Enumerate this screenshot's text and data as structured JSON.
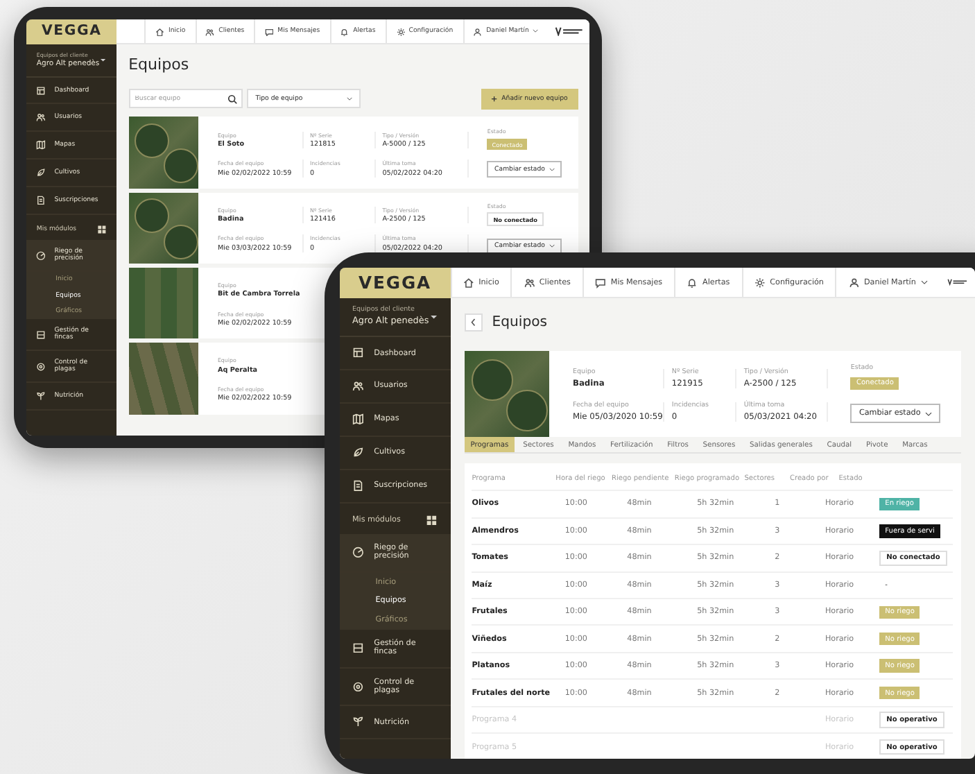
{
  "devices": [
    {
      "kind": "list",
      "header": {
        "nav": [
          {
            "label": "Inicio"
          },
          {
            "label": "Clientes"
          },
          {
            "label": "Mis Mensajes"
          },
          {
            "label": "Alertas"
          },
          {
            "label": "Configuración"
          }
        ],
        "user": "Daniel Martín"
      },
      "sidebar": {
        "logo": "VEGGA",
        "client_label": "Equipos del cliente",
        "client": "Agro Alt penedès",
        "items": [
          {
            "label": "Dashboard"
          },
          {
            "label": "Usuarios"
          },
          {
            "label": "Mapas"
          },
          {
            "label": "Cultivos"
          },
          {
            "label": "Suscripciones"
          }
        ],
        "section": "Mis módulos",
        "modules": [
          {
            "label": "Riego de precisión",
            "expanded": true,
            "children": [
              {
                "label": "Inicio",
                "selected": false
              },
              {
                "label": "Equipos",
                "selected": true
              },
              {
                "label": "Gráficos",
                "selected": false
              }
            ]
          },
          {
            "label": "Gestión de fincas",
            "expanded": false
          },
          {
            "label": "Control de plagas",
            "expanded": false
          },
          {
            "label": "Nutrición",
            "expanded": false
          }
        ]
      },
      "page": {
        "title": "Equipos",
        "search_placeholder": "Buscar equipo",
        "filter": "Tipo de equipo",
        "add_button": "Añadir nuevo equipo",
        "cards": [
          {
            "fields": [
              {
                "label": "Equipo",
                "value": "El Soto"
              },
              {
                "label": "Nº Serie",
                "value": "121815"
              },
              {
                "label": "Tipo / Versión",
                "value": "A-5000 / 125"
              },
              {
                "label": "Fecha del equipo",
                "value": "Mie 02/02/2022 10:59"
              },
              {
                "label": "Incidencias",
                "value": "0"
              },
              {
                "label": "Última toma",
                "value": "05/02/2022 04:20"
              }
            ],
            "state_label": "Estado",
            "state": {
              "label": "Conectado",
              "kind": "connected"
            },
            "button": "Cambiar estado"
          },
          {
            "fields": [
              {
                "label": "Equipo",
                "value": "Badina"
              },
              {
                "label": "Nº Serie",
                "value": "121416"
              },
              {
                "label": "Tipo / Versión",
                "value": "A-2500 / 125"
              },
              {
                "label": "Fecha del equipo",
                "value": "Mie 03/03/2022 10:59"
              },
              {
                "label": "Incidencias",
                "value": "0"
              },
              {
                "label": "Última toma",
                "value": "05/02/2022 04:20"
              }
            ],
            "state_label": "Estado",
            "state": {
              "label": "No conectado",
              "kind": "not_connected"
            },
            "button": "Cambiar estado"
          },
          {
            "fields": [
              {
                "label": "Equipo",
                "value": "Bit de Cambra Torrela"
              },
              {
                "label": "Fecha del equipo",
                "value": "Mie 02/02/2022 10:59"
              }
            ]
          },
          {
            "fields": [
              {
                "label": "Equipo",
                "value": "Aq Peralta"
              },
              {
                "label": "Fecha del equipo",
                "value": "Mie 02/02/2022 10:59"
              }
            ]
          }
        ]
      }
    },
    {
      "kind": "detail",
      "header": {
        "nav": [
          {
            "label": "Inicio"
          },
          {
            "label": "Clientes"
          },
          {
            "label": "Mis Mensajes"
          },
          {
            "label": "Alertas"
          },
          {
            "label": "Configuración"
          }
        ],
        "user": "Daniel Martín"
      },
      "sidebar": {
        "logo": "VEGGA",
        "client_label": "Equipos del cliente",
        "client": "Agro Alt penedès",
        "items": [
          {
            "label": "Dashboard"
          },
          {
            "label": "Usuarios"
          },
          {
            "label": "Mapas"
          },
          {
            "label": "Cultivos"
          },
          {
            "label": "Suscripciones"
          }
        ],
        "section": "Mis módulos",
        "modules": [
          {
            "label": "Riego de precisión",
            "expanded": true,
            "children": [
              {
                "label": "Inicio",
                "selected": false
              },
              {
                "label": "Equipos",
                "selected": true
              },
              {
                "label": "Gráficos",
                "selected": false
              }
            ]
          },
          {
            "label": "Gestión de fincas",
            "expanded": false
          },
          {
            "label": "Control de plagas",
            "expanded": false
          },
          {
            "label": "Nutrición",
            "expanded": false
          }
        ]
      },
      "page": {
        "title": "Equipos",
        "cards": [
          {
            "fields": [
              {
                "label": "Equipo",
                "value": "Badina"
              },
              {
                "label": "Nº Serie",
                "value": "121915"
              },
              {
                "label": "Tipo / Versión",
                "value": "A-2500 / 125"
              },
              {
                "label": "Fecha del equipo",
                "value": "Mie 05/03/2020 10:59"
              },
              {
                "label": "Incidencias",
                "value": "0"
              },
              {
                "label": "Última toma",
                "value": "05/03/2021 04:20"
              }
            ],
            "state_label": "Estado",
            "state": {
              "label": "Conectado",
              "kind": "connected"
            },
            "button": "Cambiar estado"
          }
        ],
        "tabs": [
          {
            "label": "Programas",
            "selected": true
          },
          {
            "label": "Sectores",
            "selected": false
          },
          {
            "label": "Mandos",
            "selected": false
          },
          {
            "label": "Fertilización",
            "selected": false
          },
          {
            "label": "Filtros",
            "selected": false
          },
          {
            "label": "Sensores",
            "selected": false
          },
          {
            "label": "Salidas generales",
            "selected": false
          },
          {
            "label": "Caudal",
            "selected": false
          },
          {
            "label": "Pivote",
            "selected": false
          },
          {
            "label": "Marcas",
            "selected": false
          }
        ],
        "table": {
          "columns": [
            "Programa",
            "Hora del riego",
            "Riego pendiente",
            "Riego programado",
            "Sectores",
            "Creado por",
            "Estado"
          ],
          "rows": [
            {
              "cells": [
                "Olivos",
                "10:00",
                "48min",
                "5h 32min",
                "1",
                "Horario"
              ],
              "status": {
                "label": "En riego",
                "kind": "irrigating"
              },
              "disabled": false
            },
            {
              "cells": [
                "Almendros",
                "10:00",
                "48min",
                "5h 32min",
                "3",
                "Horario"
              ],
              "status": {
                "label": "Fuera de servi",
                "kind": "out_of_service"
              },
              "disabled": false
            },
            {
              "cells": [
                "Tomates",
                "10:00",
                "48min",
                "5h 32min",
                "2",
                "Horario"
              ],
              "status": {
                "label": "No conectado",
                "kind": "not_connected"
              },
              "disabled": false
            },
            {
              "cells": [
                "Maíz",
                "10:00",
                "48min",
                "5h 32min",
                "3",
                "Horario"
              ],
              "status": {
                "label": "-",
                "kind": "none"
              },
              "disabled": false
            },
            {
              "cells": [
                "Frutales",
                "10:00",
                "48min",
                "5h 32min",
                "3",
                "Horario"
              ],
              "status": {
                "label": "No riego",
                "kind": "no_irrigation"
              },
              "disabled": false
            },
            {
              "cells": [
                "Viñedos",
                "10:00",
                "48min",
                "5h 32min",
                "2",
                "Horario"
              ],
              "status": {
                "label": "No riego",
                "kind": "no_irrigation"
              },
              "disabled": false
            },
            {
              "cells": [
                "Platanos",
                "10:00",
                "48min",
                "5h 32min",
                "3",
                "Horario"
              ],
              "status": {
                "label": "No riego",
                "kind": "no_irrigation"
              },
              "disabled": false
            },
            {
              "cells": [
                "Frutales del norte",
                "10:00",
                "48min",
                "5h 32min",
                "2",
                "Horario"
              ],
              "status": {
                "label": "No riego",
                "kind": "no_irrigation"
              },
              "disabled": false
            },
            {
              "cells": [
                "Programa 4",
                "",
                "",
                "",
                "",
                "Horario"
              ],
              "status": {
                "label": "No operativo",
                "kind": "inactive"
              },
              "disabled": true
            },
            {
              "cells": [
                "Programa 5",
                "",
                "",
                "",
                "",
                "Horario"
              ],
              "status": {
                "label": "No operativo",
                "kind": "inactive"
              },
              "disabled": true
            }
          ]
        }
      }
    }
  ]
}
